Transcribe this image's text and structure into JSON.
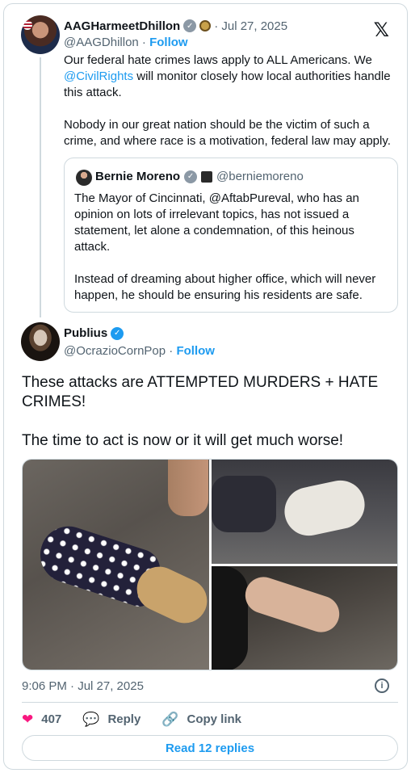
{
  "parent": {
    "name": "AAGHarmeetDhillon",
    "date": "· Jul 27, 2025",
    "handle": "@AAGDhillon",
    "separator": " · ",
    "follow": "Follow",
    "text_before": "Our federal hate crimes laws apply to ALL Americans. We ",
    "mention": "@CivilRights",
    "text_after": " will monitor closely how local authorities handle this attack.\n\nNobody in our great nation should be the victim of such a crime, and where race is a motivation, federal law may apply."
  },
  "quote": {
    "name": "Bernie Moreno",
    "handle": "@berniemoreno",
    "text": "The Mayor of Cincinnati, @AftabPureval, who has an opinion on lots of irrelevant topics, has not issued a statement, let alone a condemnation, of this heinous attack.\n\nInstead of dreaming about higher office, which will never happen, he should be ensuring his residents are safe."
  },
  "main": {
    "name": "Publius",
    "handle": "@OcrazioCornPop",
    "separator": " · ",
    "follow": "Follow",
    "text": "These attacks are ATTEMPTED MURDERS + HATE CRIMES!\n\nThe time to act is now or it will get much worse!",
    "timestamp": "9:06 PM · Jul 27, 2025"
  },
  "actions": {
    "likes": "407",
    "reply": "Reply",
    "copy": "Copy link",
    "read_replies": "Read 12 replies"
  },
  "icons": {
    "x_logo": "𝕏",
    "verified": "✓",
    "heart": "❤",
    "reply": "💬",
    "copy": "🔗",
    "info": "i"
  },
  "colors": {
    "link": "#1d9bf0",
    "like": "#f91880",
    "muted": "#536471",
    "border": "#cfd9de"
  }
}
